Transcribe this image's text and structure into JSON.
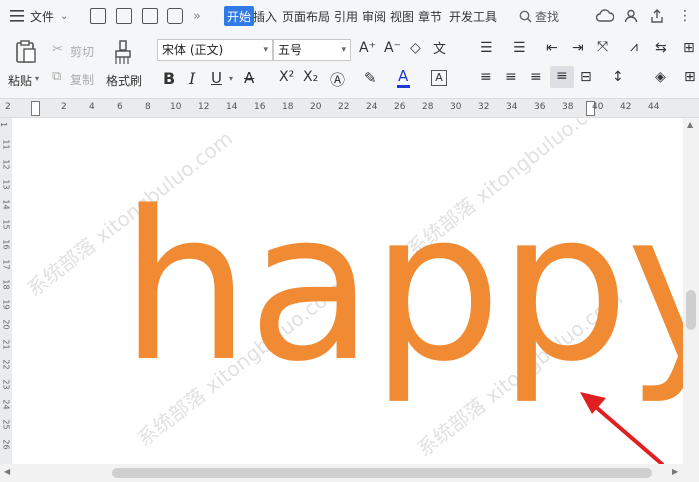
{
  "menu": {
    "file_label": "文件",
    "tabs": [
      "开始",
      "插入",
      "页面布局",
      "引用",
      "审阅",
      "视图",
      "章节",
      "开发工具"
    ],
    "search_label": "查找"
  },
  "toolbar": {
    "paste_label": "粘贴",
    "cut_label": "剪切",
    "copy_label": "复制",
    "format_painter_label": "格式刷",
    "font_name": "宋体 (正文)",
    "font_size": "五号",
    "bold": "B",
    "italic": "I",
    "underline": "U",
    "superscript": "X²",
    "subscript": "X₂"
  },
  "ruler": {
    "h_numbers": [
      "2",
      "2",
      "4",
      "6",
      "8",
      "10",
      "12",
      "14",
      "16",
      "18",
      "20",
      "22",
      "24",
      "26",
      "28",
      "30",
      "32",
      "34",
      "36",
      "38",
      "40",
      "42",
      "44"
    ],
    "v_numbers": [
      "1",
      "11",
      "12",
      "13",
      "14",
      "15",
      "16",
      "17",
      "18",
      "19",
      "20",
      "21",
      "22",
      "23",
      "24",
      "25",
      "26"
    ]
  },
  "document": {
    "text": "happy",
    "text_color": "#f08a33",
    "watermark": "系统部落 xitongbuluo.com"
  },
  "colors": {
    "accent": "#2f7ae5",
    "arrow": "#e02020"
  }
}
